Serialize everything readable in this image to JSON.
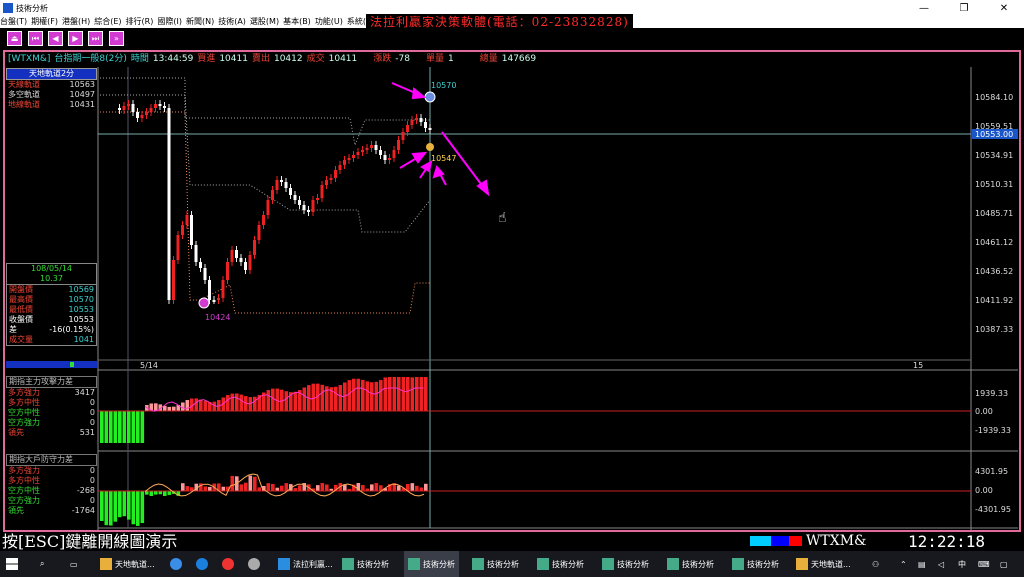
{
  "window": {
    "title": "技術分析"
  },
  "menu": [
    "台盤(T)",
    "期權(F)",
    "港盤(H)",
    "綜合(E)",
    "排行(R)",
    "國際(I)",
    "新聞(N)",
    "技術(A)",
    "選股(M)",
    "基本(B)",
    "功能(U)",
    "系統(O)"
  ],
  "brand": "法拉利贏家決策軟體(電話：02-23832828)",
  "info": {
    "symbol": "[WTXM&]",
    "name": "台指期一般8(2分)",
    "time_label": "時間",
    "time": "13:44:59",
    "bid_label": "買進",
    "bid": "10411",
    "ask_label": "賣出",
    "ask": "10412",
    "deal_label": "成交",
    "deal": "10411",
    "chg_label": "漲跌",
    "chg": "-78",
    "vol1_label": "單量",
    "vol1": "1",
    "vol_label": "總量",
    "vol": "147669"
  },
  "track": {
    "title": "天地軌道2分",
    "rows": [
      {
        "k": "天線軌道",
        "v": "10563",
        "c": "#e43"
      },
      {
        "k": "多空軌道",
        "v": "10497",
        "c": "#ddd"
      },
      {
        "k": "地線軌道",
        "v": "10431",
        "c": "#e43"
      }
    ]
  },
  "ohlc": {
    "date": "108/05/14",
    "time": "10.37",
    "rows": [
      {
        "k": "開盤價",
        "v": "10569",
        "vc": "#3bd1d1"
      },
      {
        "k": "最高價",
        "v": "10570",
        "vc": "#3bd1d1"
      },
      {
        "k": "最低價",
        "v": "10553",
        "vc": "#3bd1d1"
      },
      {
        "k": "收盤價",
        "v": "10553",
        "vc": "#fff"
      },
      {
        "k": "差",
        "v": "-16(0.15%)",
        "vc": "#fff"
      },
      {
        "k": "成交量",
        "v": "1041",
        "vc": "#3bd1d1"
      }
    ]
  },
  "price_axis": [
    "10584.10",
    "10559.51",
    "10534.91",
    "10510.31",
    "10485.71",
    "10461.12",
    "10436.52",
    "10411.92",
    "10387.33"
  ],
  "current_price": "10553.00",
  "marks": {
    "high": "10570",
    "low": "10424",
    "cursor": "10547"
  },
  "xaxis": [
    "5/14",
    "15"
  ],
  "panel1": {
    "title": "期指主力攻擊力差",
    "rows": [
      {
        "k": "多方強力",
        "v": "3417",
        "c": "#e43"
      },
      {
        "k": "多方中性",
        "v": "0",
        "c": "#e43"
      },
      {
        "k": "空方中性",
        "v": "0",
        "c": "#3d3"
      },
      {
        "k": "空方強力",
        "v": "0",
        "c": "#3d3"
      },
      {
        "k": "領先",
        "v": "531",
        "c": "#e43"
      }
    ],
    "axis": [
      "1939.33",
      "0.00",
      "-1939.33"
    ]
  },
  "panel2": {
    "title": "期指大戶防守力差",
    "rows": [
      {
        "k": "多方強力",
        "v": "0",
        "c": "#e43"
      },
      {
        "k": "多方中性",
        "v": "0",
        "c": "#e43"
      },
      {
        "k": "空方中性",
        "v": "-268",
        "c": "#3d3"
      },
      {
        "k": "空方強力",
        "v": "0",
        "c": "#3d3"
      },
      {
        "k": "領先",
        "v": "-1764",
        "c": "#3d3"
      }
    ],
    "axis": [
      "4301.95",
      "0.00",
      "-4301.95"
    ]
  },
  "status": {
    "hint": "按[ESC]鍵離開線圖演示",
    "symbol": "WTXM&",
    "clock": "12:22:18"
  },
  "taskbar": {
    "items": [
      "天地軌道...",
      "法拉利贏...",
      "技術分析",
      "技術分析",
      "技術分析",
      "技術分析",
      "技術分析",
      "技術分析",
      "技術分析",
      "天地軌道..."
    ],
    "lang": "中"
  }
}
